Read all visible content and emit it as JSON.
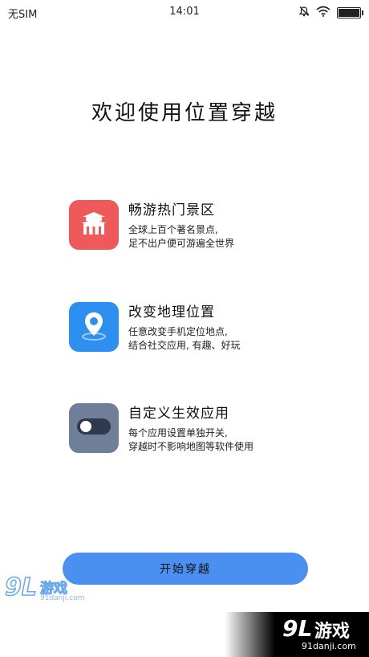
{
  "status_bar": {
    "carrier": "无SIM",
    "time": "14:01",
    "icons": [
      "bell-off-icon",
      "wifi-icon",
      "battery-icon"
    ],
    "battery_level": 1.0
  },
  "title": "欢迎使用位置穿越",
  "features": [
    {
      "icon": "temple-icon",
      "icon_color": "#f0595a",
      "title": "畅游热门景区",
      "desc_line1": "全球上百个著名景点,",
      "desc_line2": "足不出户便可游遍全世界"
    },
    {
      "icon": "location-pin-icon",
      "icon_color": "#2d8ff0",
      "title": "改变地理位置",
      "desc_line1": "任意改变手机定位地点,",
      "desc_line2": "结合社交应用, 有趣、好玩"
    },
    {
      "icon": "toggle-icon",
      "icon_color": "#6f7f99",
      "title": "自定义生效应用",
      "desc_line1": "每个应用设置单独开关,",
      "desc_line2": "穿越时不影响地图等软件使用"
    }
  ],
  "start_button": "开始穿越",
  "watermark": {
    "num": "9L",
    "name": "游戏",
    "site": "91danji.com"
  }
}
